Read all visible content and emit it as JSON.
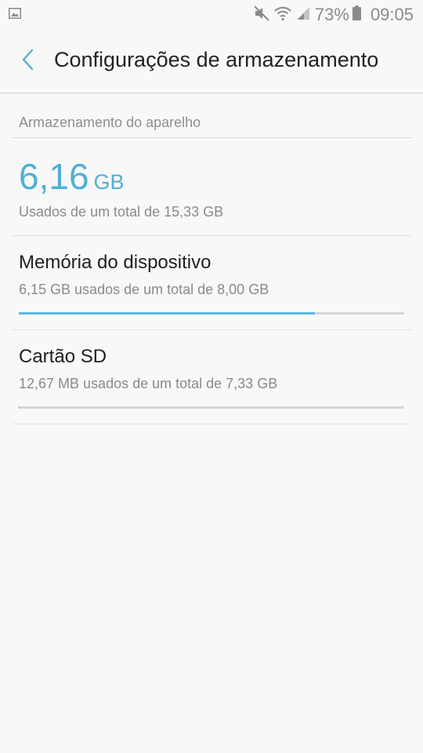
{
  "status_bar": {
    "battery_percent": "73%",
    "time": "09:05",
    "icons": [
      "image-notification-icon",
      "mute-icon",
      "wifi-icon",
      "signal-icon",
      "battery-icon"
    ]
  },
  "header": {
    "title": "Configurações de armazenamento"
  },
  "device_storage": {
    "section_title": "Armazenamento do aparelho",
    "used_value": "6,16",
    "used_unit": "GB",
    "summary": "Usados de um total de 15,33 GB"
  },
  "items": [
    {
      "title": "Memória do dispositivo",
      "subtitle": "6,15 GB usados de um total de 8,00 GB",
      "used_fraction": 0.76875
    },
    {
      "title": "Cartão SD",
      "subtitle": "12,67 MB usados de um total de 7,33 GB",
      "used_fraction": 0.0017
    }
  ],
  "colors": {
    "accent": "#4fafd6",
    "bar_fill": "#5ab9de",
    "bar_track": "#d6d6d6",
    "background": "#f8f8f8"
  }
}
